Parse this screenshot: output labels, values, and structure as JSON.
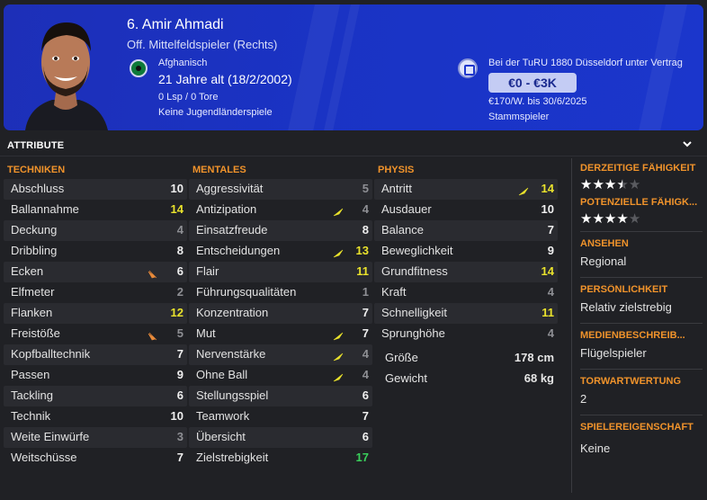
{
  "header": {
    "name": "6. Amir Ahmadi",
    "position": "Off. Mittelfeldspieler (Rechts)",
    "nationality": "Afghanisch",
    "age": "21 Jahre alt (18/2/2002)",
    "apps": "0 Lsp / 0 Tore",
    "youth": "Keine Jugendländerspiele",
    "contract": "Bei der TuRU 1880 Düsseldorf unter Vertrag",
    "wage": "€0 - €3K",
    "wage_detail": "€170/W. bis 30/6/2025",
    "squad_status": "Stammspieler"
  },
  "section": {
    "title": "ATTRIBUTE"
  },
  "technical": {
    "heading": "TECHNIKEN",
    "rows": [
      {
        "label": "Abschluss",
        "value": "10",
        "tone": "high"
      },
      {
        "label": "Ballannahme",
        "value": "14",
        "tone": "yellow"
      },
      {
        "label": "Deckung",
        "value": "4",
        "tone": "low"
      },
      {
        "label": "Dribbling",
        "value": "8",
        "tone": "high"
      },
      {
        "label": "Ecken",
        "value": "6",
        "tone": "high",
        "arrow": "orange"
      },
      {
        "label": "Elfmeter",
        "value": "2",
        "tone": "low"
      },
      {
        "label": "Flanken",
        "value": "12",
        "tone": "yellow"
      },
      {
        "label": "Freistöße",
        "value": "5",
        "tone": "low",
        "arrow": "orange"
      },
      {
        "label": "Kopfballtechnik",
        "value": "7",
        "tone": "high"
      },
      {
        "label": "Passen",
        "value": "9",
        "tone": "high"
      },
      {
        "label": "Tackling",
        "value": "6",
        "tone": "high"
      },
      {
        "label": "Technik",
        "value": "10",
        "tone": "high"
      },
      {
        "label": "Weite Einwürfe",
        "value": "3",
        "tone": "low"
      },
      {
        "label": "Weitschüsse",
        "value": "7",
        "tone": "high"
      }
    ]
  },
  "mental": {
    "heading": "MENTALES",
    "rows": [
      {
        "label": "Aggressivität",
        "value": "5",
        "tone": "low"
      },
      {
        "label": "Antizipation",
        "value": "4",
        "tone": "low",
        "arrow": "yellow"
      },
      {
        "label": "Einsatzfreude",
        "value": "8",
        "tone": "high"
      },
      {
        "label": "Entscheidungen",
        "value": "13",
        "tone": "yellow",
        "arrow": "yellow"
      },
      {
        "label": "Flair",
        "value": "11",
        "tone": "yellow"
      },
      {
        "label": "Führungsqualitäten",
        "value": "1",
        "tone": "low"
      },
      {
        "label": "Konzentration",
        "value": "7",
        "tone": "high"
      },
      {
        "label": "Mut",
        "value": "7",
        "tone": "high",
        "arrow": "yellow"
      },
      {
        "label": "Nervenstärke",
        "value": "4",
        "tone": "low",
        "arrow": "yellow"
      },
      {
        "label": "Ohne Ball",
        "value": "4",
        "tone": "low",
        "arrow": "yellow"
      },
      {
        "label": "Stellungsspiel",
        "value": "6",
        "tone": "high"
      },
      {
        "label": "Teamwork",
        "value": "7",
        "tone": "high"
      },
      {
        "label": "Übersicht",
        "value": "6",
        "tone": "high"
      },
      {
        "label": "Zielstrebigkeit",
        "value": "17",
        "tone": "green"
      }
    ]
  },
  "physical": {
    "heading": "PHYSIS",
    "rows": [
      {
        "label": "Antritt",
        "value": "14",
        "tone": "yellow",
        "arrow": "yellow"
      },
      {
        "label": "Ausdauer",
        "value": "10",
        "tone": "high"
      },
      {
        "label": "Balance",
        "value": "7",
        "tone": "high"
      },
      {
        "label": "Beweglichkeit",
        "value": "9",
        "tone": "high"
      },
      {
        "label": "Grundfitness",
        "value": "14",
        "tone": "yellow"
      },
      {
        "label": "Kraft",
        "value": "4",
        "tone": "low"
      },
      {
        "label": "Schnelligkeit",
        "value": "11",
        "tone": "yellow"
      },
      {
        "label": "Sprunghöhe",
        "value": "4",
        "tone": "low"
      }
    ],
    "height_label": "Größe",
    "height_value": "178 cm",
    "weight_label": "Gewicht",
    "weight_value": "68 kg"
  },
  "info": {
    "current_ability": {
      "heading": "DERZEITIGE FÄHIGKEIT",
      "stars": 3.5
    },
    "potential_ability": {
      "heading": "POTENZIELLE FÄHIGK...",
      "stars": 4
    },
    "reputation": {
      "heading": "ANSEHEN",
      "text": "Regional"
    },
    "personality": {
      "heading": "PERSÖNLICHKEIT",
      "text": "Relativ zielstrebig"
    },
    "media": {
      "heading": "MEDIENBESCHREIB...",
      "text": "Flügelspieler"
    },
    "gk_rating": {
      "heading": "TORWARTWERTUNG",
      "text": "2"
    },
    "traits": {
      "heading": "SPIELEREIGENSCHAFT",
      "text": "Keine"
    }
  },
  "colors": {
    "accent": "#f0932b",
    "header_blue": "#1b36cc",
    "yellow_value": "#e9e22c",
    "green_value": "#3ad05b"
  }
}
